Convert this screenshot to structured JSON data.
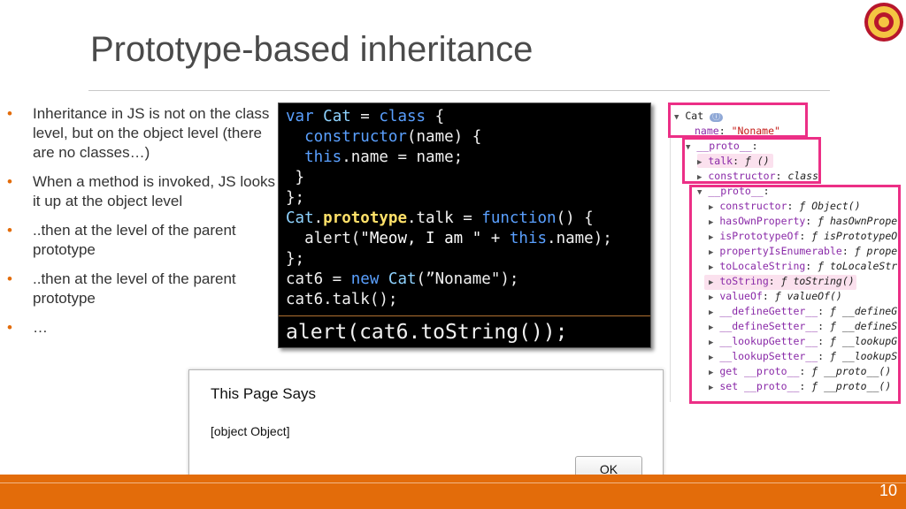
{
  "slide": {
    "title": "Prototype-based inheritance",
    "page_number": "10",
    "accent_color": "#e36c0a",
    "logo_icon": "university-seal-icon"
  },
  "bullets": [
    {
      "text": "Inheritance in JS is not on the class level, but on the object level (there are no classes…)"
    },
    {
      "text": "When a method is invoked, JS looks it up at the object level"
    },
    {
      "text": "..then at the level of the parent prototype"
    },
    {
      "text": "..then at the level of the parent prototype"
    },
    {
      "text": "…"
    }
  ],
  "bullet_char": "•",
  "code": {
    "lines": [
      [
        {
          "t": "var ",
          "c": "kw"
        },
        {
          "t": "Cat",
          "c": "tn"
        },
        {
          "t": " = ",
          "c": ""
        },
        {
          "t": "class",
          "c": "kw"
        },
        {
          "t": " {",
          "c": ""
        }
      ],
      [
        {
          "t": "  ",
          "c": ""
        },
        {
          "t": "constructor",
          "c": "kw"
        },
        {
          "t": "(name) {",
          "c": ""
        }
      ],
      [
        {
          "t": "  ",
          "c": ""
        },
        {
          "t": "this",
          "c": "kw"
        },
        {
          "t": ".name = name;",
          "c": ""
        }
      ],
      [
        {
          "t": " }",
          "c": ""
        }
      ],
      [
        {
          "t": "};",
          "c": ""
        }
      ],
      [
        {
          "t": "Cat",
          "c": "tn"
        },
        {
          "t": ".",
          "c": ""
        },
        {
          "t": "prototype",
          "c": "pr"
        },
        {
          "t": ".talk = ",
          "c": ""
        },
        {
          "t": "function",
          "c": "kw"
        },
        {
          "t": "() {",
          "c": ""
        }
      ],
      [
        {
          "t": "  alert(",
          "c": ""
        },
        {
          "t": "\"Meow, I am \"",
          "c": "st"
        },
        {
          "t": " + ",
          "c": ""
        },
        {
          "t": "this",
          "c": "kw"
        },
        {
          "t": ".name);",
          "c": ""
        }
      ],
      [
        {
          "t": "};",
          "c": ""
        }
      ],
      [
        {
          "t": "cat6 = ",
          "c": ""
        },
        {
          "t": "new ",
          "c": "kw"
        },
        {
          "t": "Cat",
          "c": "tn"
        },
        {
          "t": "(”Noname\");",
          "c": ""
        }
      ],
      [
        {
          "t": "cat6.talk();",
          "c": ""
        }
      ]
    ],
    "last_line": "alert(cat6.toString());"
  },
  "devtools": {
    "lines": [
      {
        "indent": 0,
        "arrow": "▼",
        "parts": [
          {
            "t": "Cat ",
            "c": ""
          },
          {
            "t": "ⓘ",
            "c": "info"
          }
        ]
      },
      {
        "indent": 1,
        "arrow": "",
        "parts": [
          {
            "t": "name",
            "c": "key"
          },
          {
            "t": ": ",
            "c": ""
          },
          {
            "t": "\"Noname\"",
            "c": "str"
          }
        ]
      },
      {
        "indent": 1,
        "arrow": "▼",
        "parts": [
          {
            "t": "__proto__",
            "c": "key"
          },
          {
            "t": ":",
            "c": ""
          }
        ]
      },
      {
        "indent": 2,
        "arrow": "▶",
        "parts": [
          {
            "t": "talk",
            "c": "key"
          },
          {
            "t": ": ",
            "c": ""
          },
          {
            "t": "ƒ ()",
            "c": "fn"
          }
        ]
      },
      {
        "indent": 2,
        "arrow": "▶",
        "parts": [
          {
            "t": "constructor",
            "c": "key"
          },
          {
            "t": ": ",
            "c": ""
          },
          {
            "t": "class",
            "c": "fn"
          }
        ]
      },
      {
        "indent": 2,
        "arrow": "▼",
        "parts": [
          {
            "t": "__proto__",
            "c": "key"
          },
          {
            "t": ":",
            "c": ""
          }
        ]
      },
      {
        "indent": 3,
        "arrow": "▶",
        "parts": [
          {
            "t": "constructor",
            "c": "key"
          },
          {
            "t": ": ",
            "c": ""
          },
          {
            "t": "ƒ Object()",
            "c": "fn"
          }
        ]
      },
      {
        "indent": 3,
        "arrow": "▶",
        "parts": [
          {
            "t": "hasOwnProperty",
            "c": "key"
          },
          {
            "t": ": ",
            "c": ""
          },
          {
            "t": "ƒ hasOwnPrope",
            "c": "fn"
          }
        ]
      },
      {
        "indent": 3,
        "arrow": "▶",
        "parts": [
          {
            "t": "isPrototypeOf",
            "c": "key"
          },
          {
            "t": ": ",
            "c": ""
          },
          {
            "t": "ƒ isPrototypeO",
            "c": "fn"
          }
        ]
      },
      {
        "indent": 3,
        "arrow": "▶",
        "parts": [
          {
            "t": "propertyIsEnumerable",
            "c": "key"
          },
          {
            "t": ": ",
            "c": ""
          },
          {
            "t": "ƒ prope",
            "c": "fn"
          }
        ]
      },
      {
        "indent": 3,
        "arrow": "▶",
        "parts": [
          {
            "t": "toLocaleString",
            "c": "key"
          },
          {
            "t": ": ",
            "c": ""
          },
          {
            "t": "ƒ toLocaleStr",
            "c": "fn"
          }
        ]
      },
      {
        "indent": 3,
        "arrow": "▶",
        "parts": [
          {
            "t": "toString",
            "c": "key"
          },
          {
            "t": ": ",
            "c": ""
          },
          {
            "t": "ƒ toString()",
            "c": "fn"
          }
        ]
      },
      {
        "indent": 3,
        "arrow": "▶",
        "parts": [
          {
            "t": "valueOf",
            "c": "key"
          },
          {
            "t": ": ",
            "c": ""
          },
          {
            "t": "ƒ valueOf()",
            "c": "fn"
          }
        ]
      },
      {
        "indent": 3,
        "arrow": "▶",
        "parts": [
          {
            "t": "__defineGetter__",
            "c": "key"
          },
          {
            "t": ": ",
            "c": ""
          },
          {
            "t": "ƒ __defineG",
            "c": "fn"
          }
        ]
      },
      {
        "indent": 3,
        "arrow": "▶",
        "parts": [
          {
            "t": "__defineSetter__",
            "c": "key"
          },
          {
            "t": ": ",
            "c": ""
          },
          {
            "t": "ƒ __defineS",
            "c": "fn"
          }
        ]
      },
      {
        "indent": 3,
        "arrow": "▶",
        "parts": [
          {
            "t": "__lookupGetter__",
            "c": "key"
          },
          {
            "t": ": ",
            "c": ""
          },
          {
            "t": "ƒ __lookupG",
            "c": "fn"
          }
        ]
      },
      {
        "indent": 3,
        "arrow": "▶",
        "parts": [
          {
            "t": "__lookupSetter__",
            "c": "key"
          },
          {
            "t": ": ",
            "c": ""
          },
          {
            "t": "ƒ __lookupS",
            "c": "fn"
          }
        ]
      },
      {
        "indent": 3,
        "arrow": "▶",
        "parts": [
          {
            "t": "get __proto__",
            "c": "key"
          },
          {
            "t": ": ",
            "c": ""
          },
          {
            "t": "ƒ __proto__()",
            "c": "fn"
          }
        ]
      },
      {
        "indent": 3,
        "arrow": "▶",
        "parts": [
          {
            "t": "set __proto__",
            "c": "key"
          },
          {
            "t": ": ",
            "c": ""
          },
          {
            "t": "ƒ __proto__()",
            "c": "fn"
          }
        ]
      }
    ],
    "box_color": "#ec2f86",
    "highlight_color": "#fbe1ee"
  },
  "dialog": {
    "title": "This Page Says",
    "message": "[object Object]",
    "ok_label": "OK"
  }
}
